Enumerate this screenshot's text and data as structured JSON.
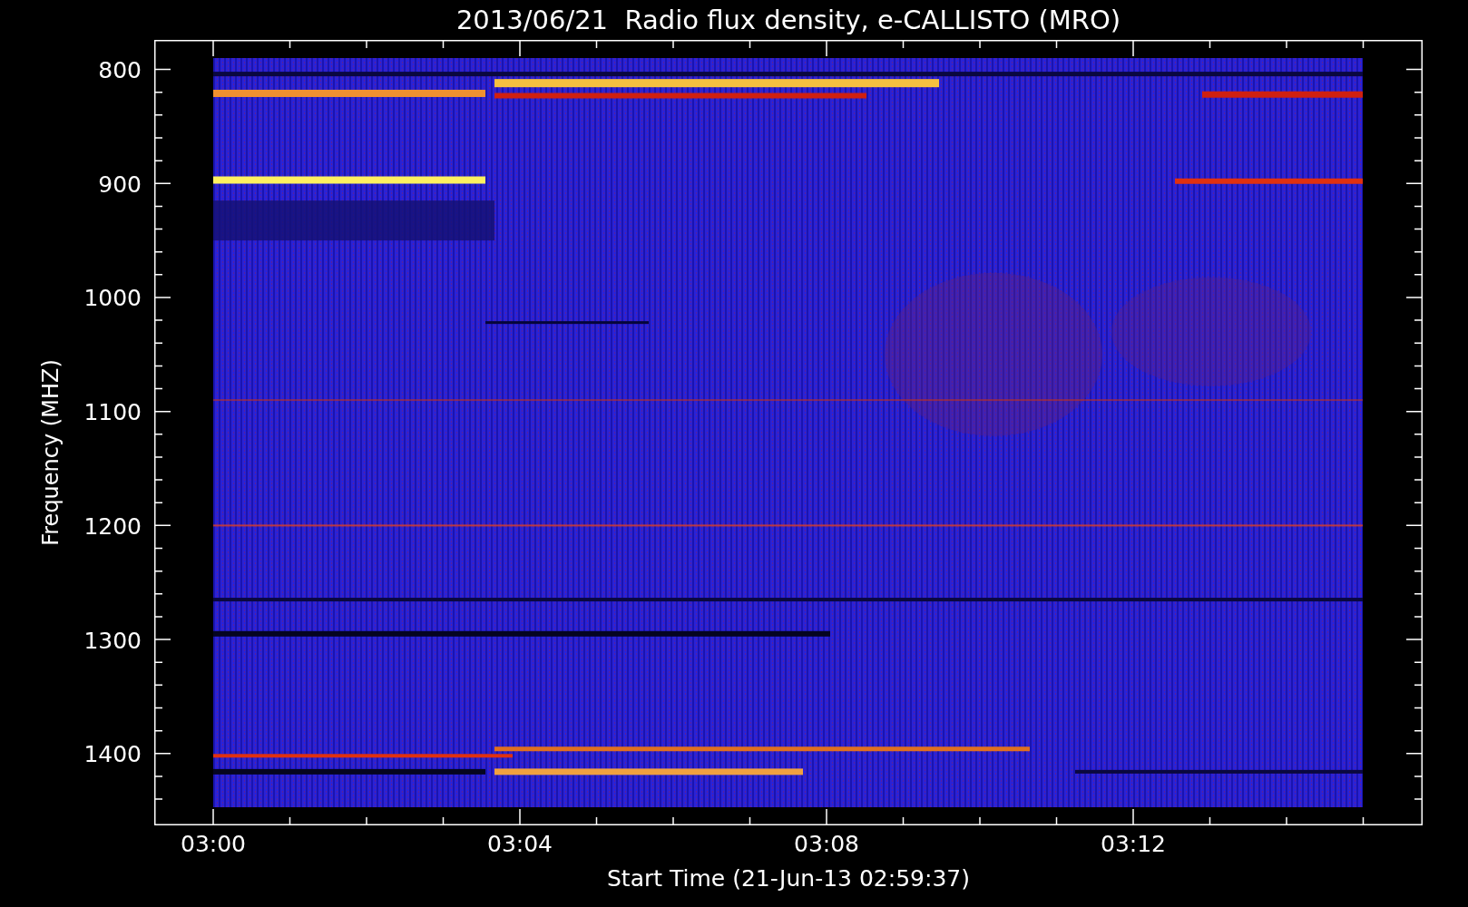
{
  "title": "2013/06/21  Radio flux density, e-CALLISTO (MRO)",
  "y_axis": {
    "label": "Frequency (MHZ)",
    "ticks": [
      "800",
      "900",
      "1000",
      "1100",
      "1200",
      "1300",
      "1400"
    ]
  },
  "x_axis": {
    "label": "Start Time (21-Jun-13 02:59:37)",
    "ticks": [
      "03:00",
      "03:04",
      "03:08",
      "03:12"
    ]
  }
}
